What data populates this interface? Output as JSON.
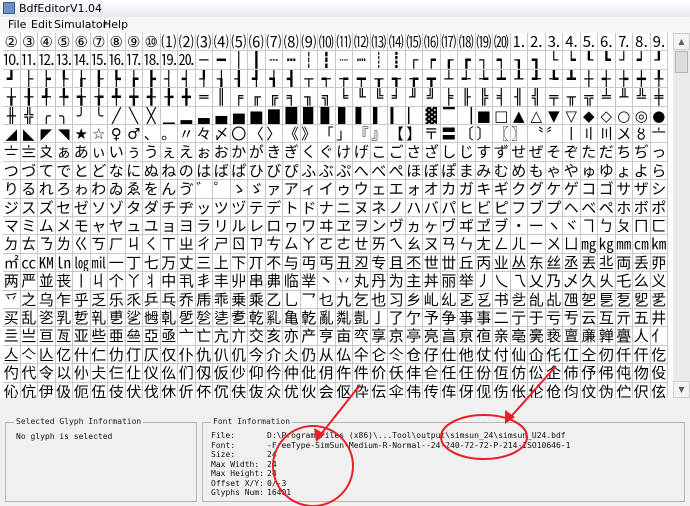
{
  "window": {
    "title": "BdfEditorV1.04"
  },
  "menu": [
    "File",
    "Edit",
    "Simulator",
    "Help"
  ],
  "grid": {
    "rows": [
      [
        "②",
        "③",
        "④",
        "⑤",
        "⑥",
        "⑦",
        "⑧",
        "⑨",
        "⑩",
        "⑴",
        "⑵",
        "⑶",
        "⑷",
        "⑸",
        "⑹",
        "⑺",
        "⑻",
        "⑼",
        "⑽",
        "⑾",
        "⑿",
        "⒀",
        "⒁",
        "⒂",
        "⒃",
        "⒄",
        "⒅",
        "⒆",
        "⒇",
        "⒈",
        "⒉",
        "⒊",
        "⒋",
        "⒌",
        "⒍",
        "⒎",
        "⒏",
        "⒐"
      ],
      [
        "⒑",
        "⒒",
        "⒓",
        "⒔",
        "⒕",
        "⒖",
        "⒗",
        "⒘",
        "⒙",
        "⒚",
        "⒛",
        "─",
        "━",
        "│",
        "┃",
        "┄",
        "┅",
        "┆",
        "┇",
        "┈",
        "┉",
        "┊",
        "┋",
        "┌",
        "┍",
        "┎",
        "┏",
        "┐",
        "┑",
        "┒",
        "┓",
        "└",
        "┕",
        "┖",
        "┗",
        "┘",
        "┙",
        "┚"
      ],
      [
        "┛",
        "├",
        "┝",
        "┞",
        "┟",
        "┠",
        "┡",
        "┢",
        "┣",
        "┤",
        "┥",
        "┦",
        "┧",
        "┨",
        "┩",
        "┪",
        "┫",
        "┬",
        "┭",
        "┮",
        "┯",
        "┰",
        "┱",
        "┲",
        "┳",
        "┴",
        "┵",
        "┶",
        "┷",
        "┸",
        "┹",
        "┺",
        "┻",
        "┼",
        "┽",
        "┾",
        "┿",
        "╀"
      ],
      [
        "╁",
        "╂",
        "╃",
        "╄",
        "╅",
        "╆",
        "╇",
        "╈",
        "╉",
        "╊",
        "╋",
        "═",
        "║",
        "╒",
        "╓",
        "╔",
        "╕",
        "╖",
        "╗",
        "╘",
        "╙",
        "╚",
        "╛",
        "╜",
        "╝",
        "╞",
        "╟",
        "╠",
        "╡",
        "╢",
        "╣",
        "╤",
        "╥",
        "╦",
        "╧",
        "╨",
        "╩",
        "╪"
      ],
      [
        "╫",
        "╬",
        "╭",
        "╮",
        "╯",
        "╰",
        "╱",
        "╲",
        "╳",
        "▁",
        "▂",
        "▃",
        "▄",
        "▅",
        "▆",
        "▇",
        "█",
        "▉",
        "▊",
        "▋",
        "▌",
        "▍",
        "▎",
        "▏",
        "▓",
        "▔",
        "▕",
        "■",
        "□",
        "▲",
        "△",
        "▼",
        "▽",
        "◆",
        "◇",
        "○",
        "◎",
        "●"
      ],
      [
        "◢",
        "◣",
        "◤",
        "◥",
        "★",
        "☆",
        "♀",
        "♂",
        "、",
        "。",
        "〃",
        "々",
        "〆",
        "〇",
        "〈",
        "〉",
        "《",
        "》",
        "「",
        "」",
        "『",
        "』",
        "【",
        "】",
        "〒",
        "〓",
        "〔",
        "〕",
        "〖",
        "〗",
        "〝",
        "〞",
        "〡",
        "〢",
        "〣",
        "〤",
        "〥",
        "〦"
      ],
      [
        "〧",
        "〨",
        "〩",
        "ぁ",
        "あ",
        "ぃ",
        "い",
        "ぅ",
        "う",
        "ぇ",
        "え",
        "ぉ",
        "お",
        "か",
        "が",
        "き",
        "ぎ",
        "く",
        "ぐ",
        "け",
        "げ",
        "こ",
        "ご",
        "さ",
        "ざ",
        "し",
        "じ",
        "す",
        "ず",
        "せ",
        "ぜ",
        "そ",
        "ぞ",
        "た",
        "だ",
        "ち",
        "ぢ",
        "っ"
      ],
      [
        "つ",
        "づ",
        "て",
        "で",
        "と",
        "ど",
        "な",
        "に",
        "ぬ",
        "ね",
        "の",
        "は",
        "ば",
        "ぱ",
        "ひ",
        "び",
        "ぴ",
        "ふ",
        "ぶ",
        "ぷ",
        "へ",
        "べ",
        "ぺ",
        "ほ",
        "ぼ",
        "ぽ",
        "ま",
        "み",
        "む",
        "め",
        "も",
        "ゃ",
        "や",
        "ゅ",
        "ゆ",
        "ょ",
        "よ",
        "ら"
      ],
      [
        "り",
        "る",
        "れ",
        "ろ",
        "ゎ",
        "わ",
        "ゐ",
        "ゑ",
        "を",
        "ん",
        "ゔ",
        "゛",
        "゜",
        "ゝ",
        "ゞ",
        "ァ",
        "ア",
        "ィ",
        "イ",
        "ゥ",
        "ウ",
        "ェ",
        "エ",
        "ォ",
        "オ",
        "カ",
        "ガ",
        "キ",
        "ギ",
        "ク",
        "グ",
        "ケ",
        "ゲ",
        "コ",
        "ゴ",
        "サ",
        "ザ",
        "シ"
      ],
      [
        "ジ",
        "ス",
        "ズ",
        "セ",
        "ゼ",
        "ソ",
        "ゾ",
        "タ",
        "ダ",
        "チ",
        "ヂ",
        "ッ",
        "ツ",
        "ヅ",
        "テ",
        "デ",
        "ト",
        "ド",
        "ナ",
        "ニ",
        "ヌ",
        "ネ",
        "ノ",
        "ハ",
        "バ",
        "パ",
        "ヒ",
        "ビ",
        "ピ",
        "フ",
        "ブ",
        "プ",
        "ヘ",
        "ベ",
        "ペ",
        "ホ",
        "ボ",
        "ポ"
      ],
      [
        "マ",
        "ミ",
        "ム",
        "メ",
        "モ",
        "ャ",
        "ヤ",
        "ュ",
        "ユ",
        "ョ",
        "ヨ",
        "ラ",
        "リ",
        "ル",
        "レ",
        "ロ",
        "ヮ",
        "ワ",
        "ヰ",
        "ヱ",
        "ヲ",
        "ン",
        "ヴ",
        "ヵ",
        "ヶ",
        "ヷ",
        "ヸ",
        "ヹ",
        "ヺ",
        "・",
        "ー",
        "ヽ",
        "ヾ",
        "ヿ",
        "ㄅ",
        "ㄆ",
        "ㄇ",
        "ㄈ"
      ],
      [
        "ㄉ",
        "ㄊ",
        "ㄋ",
        "ㄌ",
        "ㄍ",
        "ㄎ",
        "ㄏ",
        "ㄐ",
        "ㄑ",
        "ㄒ",
        "ㄓ",
        "ㄔ",
        "ㄕ",
        "ㄖ",
        "ㄗ",
        "ㄘ",
        "ㄙ",
        "ㄚ",
        "ㄛ",
        "ㄜ",
        "ㄝ",
        "ㄞ",
        "ㄟ",
        "ㄠ",
        "ㄡ",
        "ㄢ",
        "ㄣ",
        "ㄤ",
        "ㄥ",
        "ㄦ",
        "ㄧ",
        "ㄨ",
        "ㄩ",
        "㎎",
        "㎏",
        "㎜",
        "㎝",
        "㎞"
      ],
      [
        "㎡",
        "㏄",
        "㏎",
        "㏑",
        "㏒",
        "㏕",
        "一",
        "丁",
        "七",
        "万",
        "丈",
        "三",
        "上",
        "下",
        "丌",
        "不",
        "与",
        "丏",
        "丐",
        "丑",
        "丒",
        "专",
        "且",
        "丕",
        "世",
        "丗",
        "丘",
        "丙",
        "业",
        "丛",
        "东",
        "丝",
        "丞",
        "丟",
        "丠",
        "両",
        "丢",
        "丣"
      ],
      [
        "两",
        "严",
        "並",
        "丧",
        "丨",
        "丩",
        "个",
        "丫",
        "丬",
        "中",
        "丮",
        "丯",
        "丰",
        "丱",
        "串",
        "丳",
        "临",
        "丵",
        "丶",
        "丷",
        "丸",
        "丹",
        "为",
        "主",
        "丼",
        "丽",
        "举",
        "丿",
        "乀",
        "乁",
        "乂",
        "乃",
        "乄",
        "久",
        "乆",
        "乇",
        "么",
        "义"
      ],
      [
        "乊",
        "之",
        "乌",
        "乍",
        "乎",
        "乏",
        "乐",
        "乑",
        "乒",
        "乓",
        "乔",
        "乕",
        "乖",
        "乗",
        "乘",
        "乙",
        "乚",
        "乛",
        "乜",
        "九",
        "乞",
        "也",
        "习",
        "乡",
        "乢",
        "乣",
        "乤",
        "乥",
        "书",
        "乧",
        "乨",
        "乩",
        "乪",
        "乫",
        "乬",
        "乭",
        "乮",
        "乯"
      ],
      [
        "买",
        "乱",
        "乲",
        "乳",
        "乴",
        "乵",
        "乶",
        "乷",
        "乸",
        "乹",
        "乺",
        "乻",
        "乼",
        "乽",
        "乾",
        "乿",
        "亀",
        "亁",
        "亂",
        "亃",
        "亄",
        "亅",
        "了",
        "亇",
        "予",
        "争",
        "亊",
        "事",
        "二",
        "亍",
        "于",
        "亏",
        "亐",
        "云",
        "互",
        "亓",
        "五",
        "井"
      ],
      [
        "亖",
        "亗",
        "亘",
        "亙",
        "亚",
        "些",
        "亜",
        "亝",
        "亞",
        "亟",
        "亠",
        "亡",
        "亢",
        "亣",
        "交",
        "亥",
        "亦",
        "产",
        "亨",
        "亩",
        "亪",
        "享",
        "京",
        "亭",
        "亮",
        "亯",
        "亰",
        "亱",
        "亲",
        "亳",
        "亴",
        "亵",
        "亶",
        "亷",
        "亸",
        "亹",
        "人",
        "亻"
      ],
      [
        "亼",
        "亽",
        "亾",
        "亿",
        "什",
        "仁",
        "仂",
        "仃",
        "仄",
        "仅",
        "仆",
        "仇",
        "仈",
        "仉",
        "今",
        "介",
        "仌",
        "仍",
        "从",
        "仏",
        "仐",
        "仑",
        "仒",
        "仓",
        "仔",
        "仕",
        "他",
        "仗",
        "付",
        "仙",
        "仚",
        "仛",
        "仜",
        "仝",
        "仞",
        "仟",
        "仠",
        "仡"
      ],
      [
        "仢",
        "代",
        "令",
        "以",
        "仦",
        "仧",
        "仨",
        "仩",
        "仪",
        "仫",
        "们",
        "仭",
        "仮",
        "仯",
        "仰",
        "仱",
        "仲",
        "仳",
        "仴",
        "仵",
        "件",
        "价",
        "仸",
        "仹",
        "仺",
        "任",
        "仼",
        "份",
        "仾",
        "仿",
        "伀",
        "企",
        "伂",
        "伃",
        "伄",
        "伅",
        "伆",
        "伇"
      ],
      [
        "伈",
        "伉",
        "伊",
        "伋",
        "伌",
        "伍",
        "伎",
        "伏",
        "伐",
        "休",
        "伒",
        "伓",
        "伔",
        "伕",
        "伖",
        "众",
        "优",
        "伙",
        "会",
        "伛",
        "伜",
        "伝",
        "伞",
        "伟",
        "传",
        "伡",
        "伢",
        "伣",
        "伤",
        "伥",
        "伦",
        "伧",
        "伨",
        "伩",
        "伪",
        "伫",
        "伬",
        "伭"
      ],
      [
        "伮",
        "伯",
        "估",
        "伱",
        "伲",
        "伳",
        "伴",
        "伵",
        "伶",
        "伷",
        "伸",
        "伹",
        "伺",
        "伻",
        "似",
        "伽",
        "伾",
        "伿",
        "佀",
        "佁",
        "佂",
        "佃",
        "佄",
        "佅",
        "但",
        "佇",
        "佈",
        "佉",
        "佊",
        "佋",
        "佌",
        "位",
        "低",
        "住",
        "佐",
        "佑",
        "佒",
        "体"
      ],
      [
        "佔",
        "何",
        "佖",
        "佗",
        "佘",
        "余",
        "佚",
        "佛",
        "作",
        "佝",
        "佞",
        "佟",
        "你",
        "佡",
        "佢",
        "佣",
        "佤",
        "佥",
        "佦",
        "佧",
        "佨",
        "佩",
        "佪",
        "佫",
        "佬",
        "佭",
        "佮",
        "佯",
        "佰",
        "佱",
        "佲",
        "佳",
        "佴",
        "併",
        "佶",
        "佷",
        "佸",
        "佹"
      ],
      [
        "佺",
        "佻",
        "佼",
        "佽",
        "佾",
        "使",
        "侀",
        "侁",
        "侂",
        "侃",
        "侄",
        "侅",
        "來",
        "侇",
        "侈",
        "侉",
        "侊",
        "例",
        "侌",
        "侍",
        "侎",
        "侏",
        "侐",
        "侑",
        "侒",
        "侓",
        "侔",
        "侕",
        "侖",
        "侗",
        "侘",
        "侙",
        "侚",
        "供",
        "侜",
        "依",
        "侞",
        "侟"
      ],
      [
        "侠",
        "価",
        "侢",
        "侣",
        "侤",
        "侥",
        "侦",
        "侧",
        "侨",
        "侩",
        "侪",
        "侫",
        "侬",
        "侭",
        "侮",
        "侯",
        "侰",
        "侱",
        "侲",
        "侳",
        "侴",
        "侵",
        "侶",
        "侷",
        "侸",
        "侹",
        "侺",
        "侻",
        "侼",
        "侽",
        "侾",
        "便",
        "俀",
        "俁",
        "係",
        "促",
        "俄",
        "俅"
      ]
    ]
  },
  "selected_glyph": {
    "title": "Selected Glyph Information",
    "message": "No glyph is selected"
  },
  "font_info": {
    "title": "Font Information",
    "rows": [
      {
        "label": "File:",
        "value": "D:\\Program Files (x86)\\...Tool\\output\\simsun_24\\simsun_U24.bdf"
      },
      {
        "label": "Font:",
        "value": "-FreeType-SimSun-Medium-R-Normal--24-240-72-72-P-214-ISO10646-1"
      },
      {
        "label": "Size:",
        "value": "24"
      },
      {
        "label": "Max Width:",
        "value": "24"
      },
      {
        "label": "Max Height:",
        "value": "24"
      },
      {
        "label": "Offset X/Y:",
        "value": "0/-3"
      },
      {
        "label": "Glyphs Num:",
        "value": "16401"
      }
    ]
  },
  "colors": {
    "annotation": "#e8202a",
    "window_bg": "#f0f0f0"
  }
}
